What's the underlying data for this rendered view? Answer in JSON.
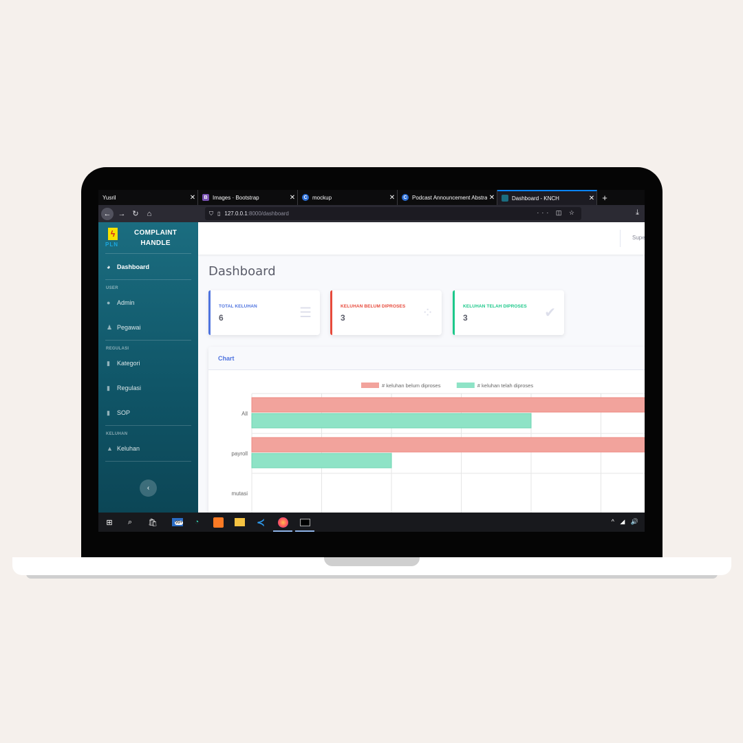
{
  "browser": {
    "tabs": [
      {
        "label": "Yusril",
        "favicon": "none",
        "active": false
      },
      {
        "label": "Images · Bootstrap",
        "favicon": "bootstrap-icon",
        "active": false
      },
      {
        "label": "mockup",
        "favicon": "canva-icon",
        "active": false
      },
      {
        "label": "Podcast Announcement Abstra",
        "favicon": "canva-icon",
        "active": false
      },
      {
        "label": "Dashboard - KNCH",
        "favicon": "site-icon",
        "active": true
      }
    ],
    "close_glyph": "✕",
    "new_tab_glyph": "+",
    "url_host": "127.0.0.1",
    "url_path": ":8000/dashboard"
  },
  "sidebar": {
    "brand_line1": "COMPLAINT",
    "brand_line2": "HANDLE",
    "logo_text": "PLN",
    "dashboard": "Dashboard",
    "heading_user": "USER",
    "admin": "Admin",
    "pegawai": "Pegawai",
    "heading_regulasi": "REGULASI",
    "kategori": "Kategori",
    "regulasi": "Regulasi",
    "sop": "SOP",
    "heading_keluhan": "KELUHAN",
    "keluhan": "Keluhan",
    "toggle_glyph": "‹"
  },
  "topbar": {
    "user": "Super"
  },
  "main": {
    "title": "Dashboard",
    "cards": [
      {
        "label": "TOTAL KELUHAN",
        "value": "6",
        "color": "#4e73df",
        "icon": "list-icon"
      },
      {
        "label": "KELUHAN BELUM DIPROSES",
        "value": "3",
        "color": "#e74a3b",
        "icon": "spinner-icon"
      },
      {
        "label": "KELUHAN TELAH DIPROSES",
        "value": "3",
        "color": "#1cc88a",
        "icon": "check-icon"
      }
    ]
  },
  "chart_panel": {
    "title": "Chart"
  },
  "chart_data": {
    "type": "bar",
    "orientation": "horizontal",
    "categories": [
      "All",
      "payroll",
      "mutasi"
    ],
    "series": [
      {
        "name": "# keluhan belum diproses",
        "values": [
          3,
          3,
          0
        ],
        "color": "#f2a39c"
      },
      {
        "name": "# keluhan telah diproses",
        "values": [
          2,
          1,
          0
        ],
        "color": "#8ee3c6"
      }
    ],
    "xlim": [
      0,
      3
    ],
    "grid": true,
    "legend": "top-center"
  },
  "taskbar": {
    "store_badge": "99+",
    "tray": "^ ◢ 🔊"
  }
}
